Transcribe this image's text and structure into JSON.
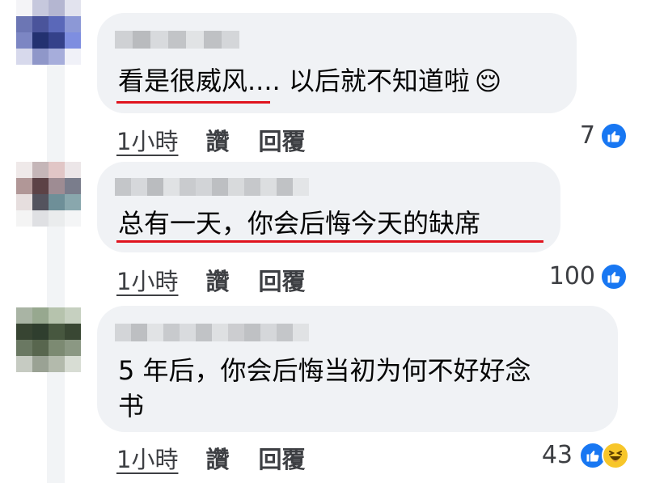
{
  "comments": [
    {
      "text": "看是很威风.... 以后就不知道啦",
      "emoji": "😌",
      "time": "1小時",
      "like_label": "讚",
      "reply_label": "回覆",
      "reaction_count": "7",
      "reactions": [
        "like"
      ]
    },
    {
      "text": "总有一天，你会后悔今天的缺席",
      "time": "1小時",
      "like_label": "讚",
      "reply_label": "回覆",
      "reaction_count": "100",
      "reactions": [
        "like"
      ]
    },
    {
      "text_line1": "5 年后，你会后悔当初为何不好好念",
      "text_line2": "书",
      "time": "1小時",
      "like_label": "讚",
      "reply_label": "回覆",
      "reaction_count": "43",
      "reactions": [
        "like",
        "haha"
      ]
    }
  ],
  "colors": {
    "bubble": "#f0f2f5",
    "like_blue": "#1877f2",
    "underline_red": "#e0141e",
    "haha_yellow": "#f7c62a"
  }
}
